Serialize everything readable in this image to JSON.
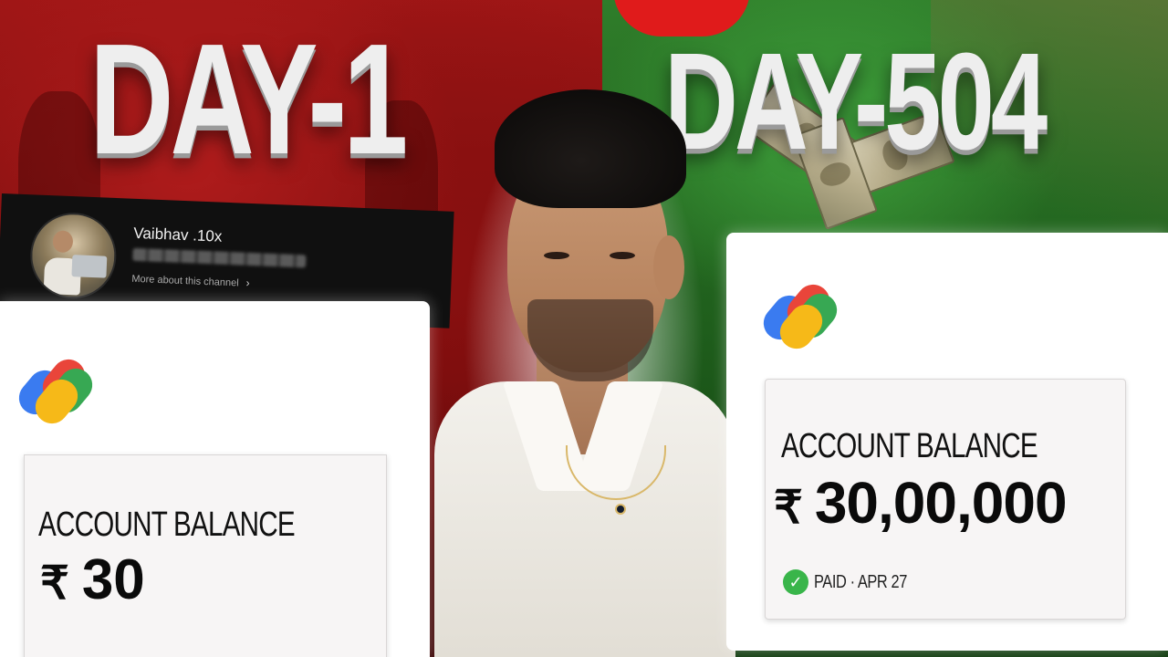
{
  "headlines": {
    "left": "DAY-1",
    "right": "DAY-504"
  },
  "channel": {
    "name": "Vaibhav .10x",
    "more_link": "More about this channel",
    "chevron_icon": "chevron-right-icon"
  },
  "left_panel": {
    "logo": "google-pay-icon",
    "label": "ACCOUNT BALANCE",
    "currency": "₹",
    "amount": "30"
  },
  "right_panel": {
    "logo": "google-pay-icon",
    "label": "ACCOUNT BALANCE",
    "currency": "₹",
    "amount": "30,00,000",
    "status": "PAID · APR 27",
    "status_icon": "check-circle-icon"
  },
  "colors": {
    "left_bg": "#a01616",
    "right_bg": "#2f7d2a",
    "paid_green": "#39b54a"
  }
}
